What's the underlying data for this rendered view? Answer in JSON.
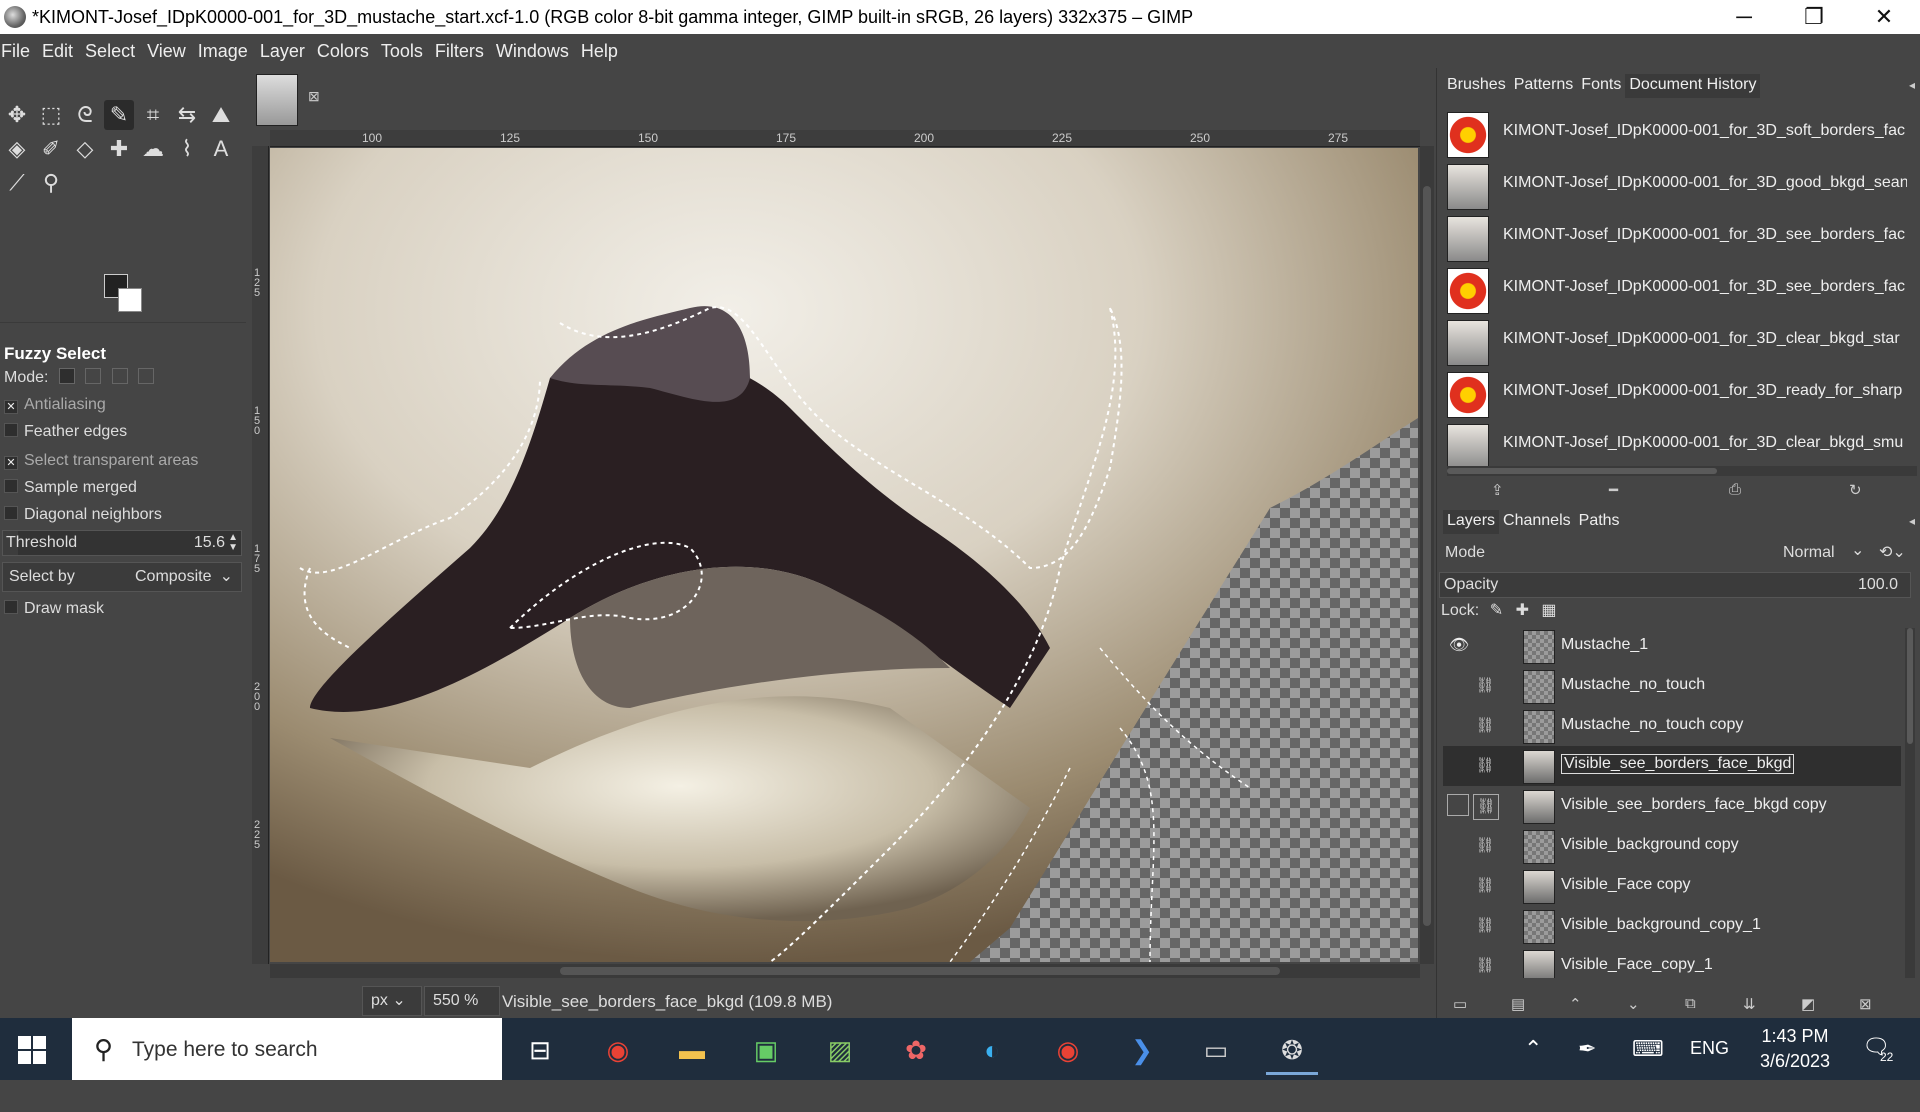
{
  "window": {
    "title": "*KIMONT-Josef_IDpK0000-001_for_3D_mustache_start.xcf-1.0 (RGB color 8-bit gamma integer, GIMP built-in sRGB, 26 layers) 332x375 – GIMP",
    "minimize": "─",
    "restore": "❐",
    "close": "✕"
  },
  "menu": [
    "File",
    "Edit",
    "Select",
    "View",
    "Image",
    "Layer",
    "Colors",
    "Tools",
    "Filters",
    "Windows",
    "Help"
  ],
  "tool_options": {
    "title": "Fuzzy Select",
    "mode_label": "Mode:",
    "antialiasing": "Antialiasing",
    "feather_edges": "Feather edges",
    "select_transparent": "Select transparent areas",
    "sample_merged": "Sample merged",
    "diagonal_neighbors": "Diagonal neighbors",
    "threshold_label": "Threshold",
    "threshold_value": "15.6",
    "threshold_fraction": 0.061,
    "select_by_label": "Select by",
    "select_by_value": "Composite",
    "draw_mask": "Draw mask"
  },
  "ruler": {
    "ticks": [
      "100",
      "125",
      "150",
      "175",
      "200",
      "225",
      "250",
      "275"
    ],
    "vertical_ticks": [
      "125",
      "150",
      "175",
      "200",
      "225",
      "250"
    ]
  },
  "status": {
    "unit": "px",
    "zoom": "550 %",
    "text": "Visible_see_borders_face_bkgd (109.8 MB)"
  },
  "dock_top": {
    "tabs": [
      "Brushes",
      "Patterns",
      "Fonts",
      "Document History"
    ],
    "history": [
      {
        "name": "KIMONT-Josef_IDpK0000-001_for_3D_soft_borders_fac",
        "thumb": "flower"
      },
      {
        "name": "KIMONT-Josef_IDpK0000-001_for_3D_good_bkgd_sean",
        "thumb": "face"
      },
      {
        "name": "KIMONT-Josef_IDpK0000-001_for_3D_see_borders_fac",
        "thumb": "face"
      },
      {
        "name": "KIMONT-Josef_IDpK0000-001_for_3D_see_borders_fac",
        "thumb": "flower"
      },
      {
        "name": "KIMONT-Josef_IDpK0000-001_for_3D_clear_bkgd_star",
        "thumb": "face"
      },
      {
        "name": "KIMONT-Josef_IDpK0000-001_for_3D_ready_for_sharp",
        "thumb": "flower"
      },
      {
        "name": "KIMONT-Josef_IDpK0000-001_for_3D_clear_bkgd_smu",
        "thumb": "face"
      }
    ]
  },
  "dock_layers": {
    "tabs": [
      "Layers",
      "Channels",
      "Paths"
    ],
    "mode_label": "Mode",
    "mode_value": "Normal",
    "opacity_label": "Opacity",
    "opacity_value": "100.0",
    "lock_label": "Lock:",
    "layers": [
      {
        "name": "Mustache_1",
        "visible": true,
        "thumb": "checker"
      },
      {
        "name": "Mustache_no_touch",
        "visible": false,
        "thumb": "checker"
      },
      {
        "name": "Mustache_no_touch copy",
        "visible": false,
        "thumb": "checker"
      },
      {
        "name": "Visible_see_borders_face_bkgd",
        "visible": false,
        "thumb": "face",
        "selected": true
      },
      {
        "name": "Visible_see_borders_face_bkgd copy",
        "visible": false,
        "thumb": "face"
      },
      {
        "name": "Visible_background copy",
        "visible": false,
        "thumb": "checker"
      },
      {
        "name": "Visible_Face copy",
        "visible": false,
        "thumb": "face"
      },
      {
        "name": "Visible_background_copy_1",
        "visible": false,
        "thumb": "checker"
      },
      {
        "name": "Visible_Face_copy_1",
        "visible": false,
        "thumb": "face"
      }
    ]
  },
  "taskbar": {
    "search_placeholder": "Type here to search",
    "language": "ENG",
    "time": "1:43 PM",
    "date": "3/6/2023",
    "notifications": "22"
  }
}
